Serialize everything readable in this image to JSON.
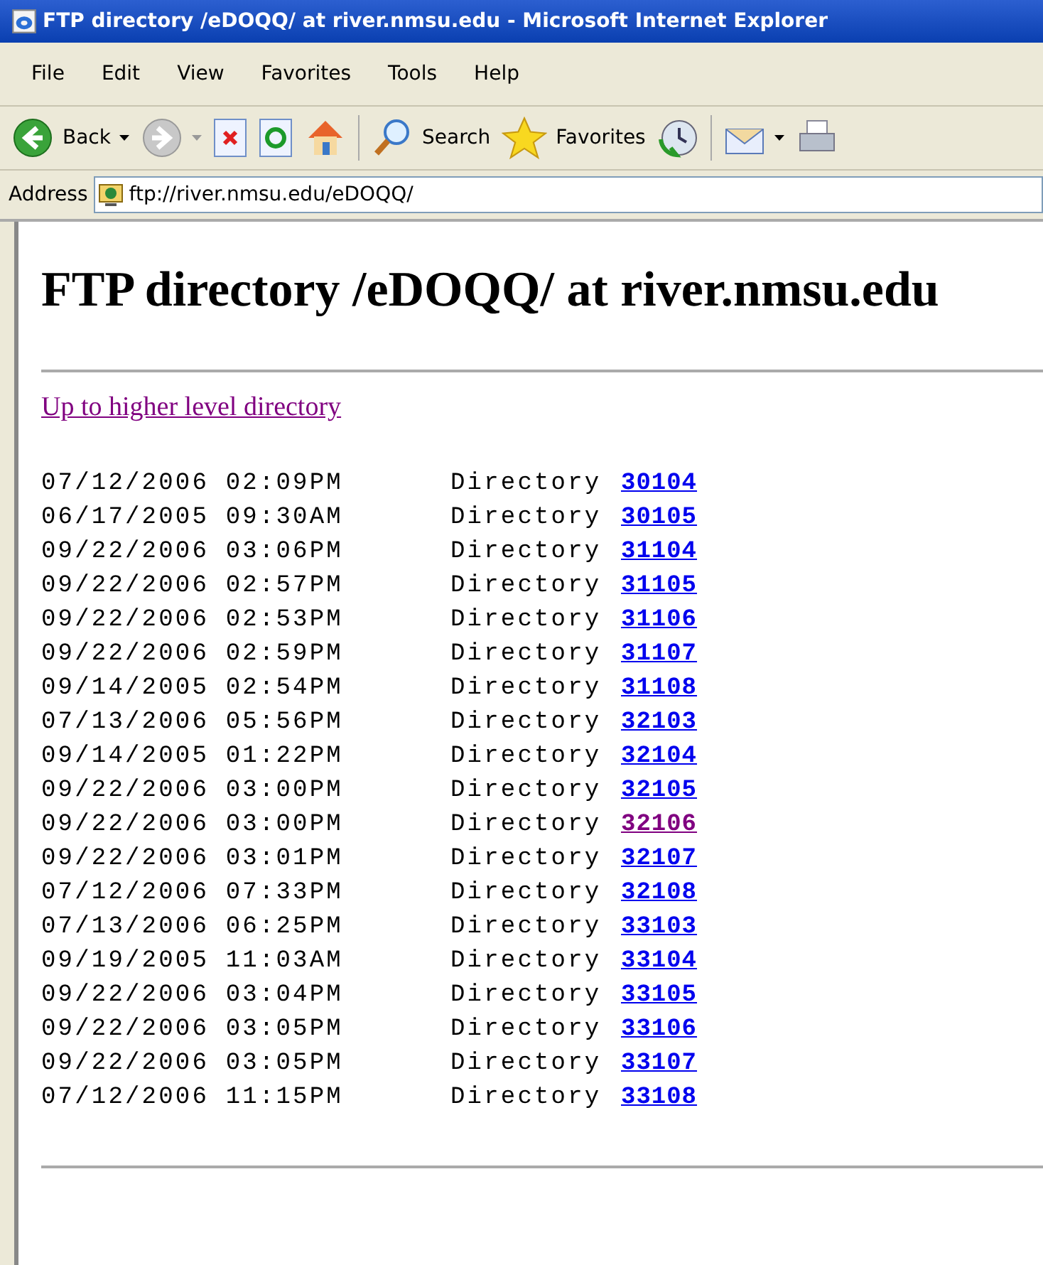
{
  "window": {
    "title": "FTP directory /eDOQQ/ at river.nmsu.edu - Microsoft Internet Explorer"
  },
  "menu": [
    "File",
    "Edit",
    "View",
    "Favorites",
    "Tools",
    "Help"
  ],
  "toolbar": [
    {
      "kind": "back",
      "label": "Back"
    },
    {
      "kind": "forward"
    },
    {
      "kind": "stop"
    },
    {
      "kind": "refresh"
    },
    {
      "kind": "home"
    },
    {
      "kind": "separator"
    },
    {
      "kind": "search",
      "label": "Search"
    },
    {
      "kind": "favorites",
      "label": "Favorites"
    },
    {
      "kind": "history"
    },
    {
      "kind": "separator"
    },
    {
      "kind": "mail"
    },
    {
      "kind": "print"
    }
  ],
  "address": {
    "label": "Address",
    "value": "ftp://river.nmsu.edu/eDOQQ/"
  },
  "page": {
    "heading": "FTP directory /eDOQQ/ at river.nmsu.edu",
    "up_link": {
      "text": "Up to higher level directory",
      "visited": true
    },
    "entries": [
      {
        "date": "07/12/2006 02:09PM",
        "type": "Directory",
        "name": "30104",
        "visited": false
      },
      {
        "date": "06/17/2005 09:30AM",
        "type": "Directory",
        "name": "30105",
        "visited": false
      },
      {
        "date": "09/22/2006 03:06PM",
        "type": "Directory",
        "name": "31104",
        "visited": false
      },
      {
        "date": "09/22/2006 02:57PM",
        "type": "Directory",
        "name": "31105",
        "visited": false
      },
      {
        "date": "09/22/2006 02:53PM",
        "type": "Directory",
        "name": "31106",
        "visited": false
      },
      {
        "date": "09/22/2006 02:59PM",
        "type": "Directory",
        "name": "31107",
        "visited": false
      },
      {
        "date": "09/14/2005 02:54PM",
        "type": "Directory",
        "name": "31108",
        "visited": false
      },
      {
        "date": "07/13/2006 05:56PM",
        "type": "Directory",
        "name": "32103",
        "visited": false
      },
      {
        "date": "09/14/2005 01:22PM",
        "type": "Directory",
        "name": "32104",
        "visited": false
      },
      {
        "date": "09/22/2006 03:00PM",
        "type": "Directory",
        "name": "32105",
        "visited": false
      },
      {
        "date": "09/22/2006 03:00PM",
        "type": "Directory",
        "name": "32106",
        "visited": true
      },
      {
        "date": "09/22/2006 03:01PM",
        "type": "Directory",
        "name": "32107",
        "visited": false
      },
      {
        "date": "07/12/2006 07:33PM",
        "type": "Directory",
        "name": "32108",
        "visited": false
      },
      {
        "date": "07/13/2006 06:25PM",
        "type": "Directory",
        "name": "33103",
        "visited": false
      },
      {
        "date": "09/19/2005 11:03AM",
        "type": "Directory",
        "name": "33104",
        "visited": false
      },
      {
        "date": "09/22/2006 03:04PM",
        "type": "Directory",
        "name": "33105",
        "visited": false
      },
      {
        "date": "09/22/2006 03:05PM",
        "type": "Directory",
        "name": "33106",
        "visited": false
      },
      {
        "date": "09/22/2006 03:05PM",
        "type": "Directory",
        "name": "33107",
        "visited": false
      },
      {
        "date": "07/12/2006 11:15PM",
        "type": "Directory",
        "name": "33108",
        "visited": false
      }
    ]
  }
}
